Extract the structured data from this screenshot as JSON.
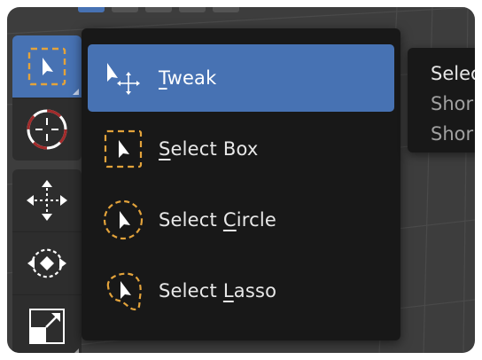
{
  "header": {
    "select_modes": [
      "select-box-mode-icon",
      "select-extend-icon",
      "select-subtract-icon",
      "select-invert-icon",
      "select-intersect-icon"
    ],
    "active_mode": 0
  },
  "toolbar": {
    "tools": [
      {
        "name": "select-box-tool",
        "icon": "select-box-icon",
        "active": true,
        "has_submenu": true
      },
      {
        "name": "cursor-tool",
        "icon": "cursor-3d-icon",
        "active": false,
        "has_submenu": false
      },
      {
        "name": "move-tool",
        "icon": "move-arrows-icon",
        "active": false,
        "has_submenu": false
      },
      {
        "name": "rotate-tool",
        "icon": "rotate-icon",
        "active": false,
        "has_submenu": false
      },
      {
        "name": "scale-tool",
        "icon": "scale-icon",
        "active": false,
        "has_submenu": true
      }
    ]
  },
  "menu": {
    "items": [
      {
        "pre": "",
        "key": "T",
        "post": "weak",
        "icon": "tweak-icon",
        "selected": true
      },
      {
        "pre": "",
        "key": "S",
        "post": "elect Box",
        "icon": "select-box-icon",
        "selected": false
      },
      {
        "pre": "Select ",
        "key": "C",
        "post": "ircle",
        "icon": "select-circle-icon",
        "selected": false
      },
      {
        "pre": "Select ",
        "key": "L",
        "post": "asso",
        "icon": "select-lasso-icon",
        "selected": false
      }
    ]
  },
  "tooltip": {
    "title": "Selec",
    "line1": "Shor",
    "line2": "Shor"
  },
  "colors": {
    "accent": "#4772b3",
    "select_orange": "#e3a33b",
    "cursor_red": "#a22a2a"
  }
}
